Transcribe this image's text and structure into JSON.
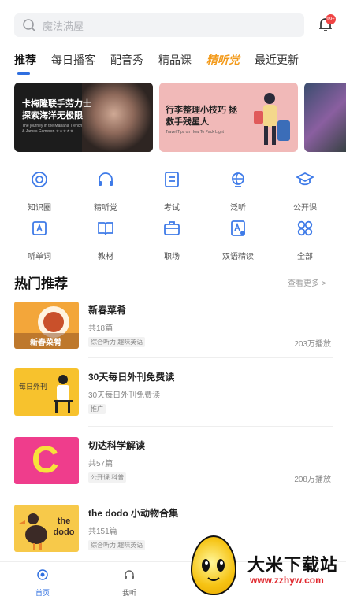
{
  "search": {
    "placeholder": "魔法满屋",
    "icon": "search-icon"
  },
  "notification": {
    "icon": "bell-icon",
    "badge": "99+"
  },
  "tabs": [
    "推荐",
    "每日播客",
    "配音秀",
    "精品课",
    "精听党",
    "最近更新"
  ],
  "banners": [
    {
      "title": "卡梅隆联手劳力士 探索海洋无极限",
      "subtitle": "The journey in the Mariana Trench & James Cameron ★★★★★"
    },
    {
      "title": "行李整理小技巧 拯救手残星人",
      "subtitle": "Travel Tips on How To Pack Light"
    },
    {
      "title": ""
    }
  ],
  "categories": [
    {
      "label": "知识圈",
      "icon": "knowledge-circle-icon"
    },
    {
      "label": "精听党",
      "icon": "headset-icon"
    },
    {
      "label": "考试",
      "icon": "exam-icon"
    },
    {
      "label": "泛听",
      "icon": "globe-icon"
    },
    {
      "label": "公开课",
      "icon": "graduation-cap-icon"
    },
    {
      "label": "听单词",
      "icon": "word-card-icon"
    },
    {
      "label": "教材",
      "icon": "book-icon"
    },
    {
      "label": "职场",
      "icon": "briefcase-icon"
    },
    {
      "label": "双语精读",
      "icon": "bilingual-doc-icon"
    },
    {
      "label": "全部",
      "icon": "all-grid-icon"
    }
  ],
  "section": {
    "title": "热门推荐",
    "more": "查看更多 >"
  },
  "items": [
    {
      "title": "新春菜肴",
      "count": "共18篇",
      "tag": "综合听力 趣味英语",
      "plays": "203万播放",
      "thumb_text": "新春菜肴",
      "thumb_color": "#f3a63a"
    },
    {
      "title": "30天每日外刊免费读",
      "count": "30天每日外刊免费读",
      "tag": "推广",
      "plays": "",
      "thumb_text": "每日外刊",
      "thumb_color": "#f7c22d"
    },
    {
      "title": "切达科学解读",
      "count": "共57篇",
      "tag": "公开课 科普",
      "plays": "208万播放",
      "thumb_text": "C",
      "thumb_color": "#ef3d8c"
    },
    {
      "title": "the dodo 小动物合集",
      "count": "共151篇",
      "tag": "综合听力 趣味英语",
      "plays": "",
      "thumb_text": "the dodo",
      "thumb_color": "#f7c94a"
    }
  ],
  "bottom_nav": [
    {
      "label": "首页",
      "icon": "home-icon",
      "active": true
    },
    {
      "label": "我听",
      "icon": "headphones-icon",
      "active": false
    }
  ],
  "watermark": {
    "site": "大米下载站",
    "url": "www.zzhyw.com"
  },
  "colors": {
    "accent": "#2f6fe0",
    "special_tab": "#f39a1a",
    "badge": "#f04444"
  }
}
